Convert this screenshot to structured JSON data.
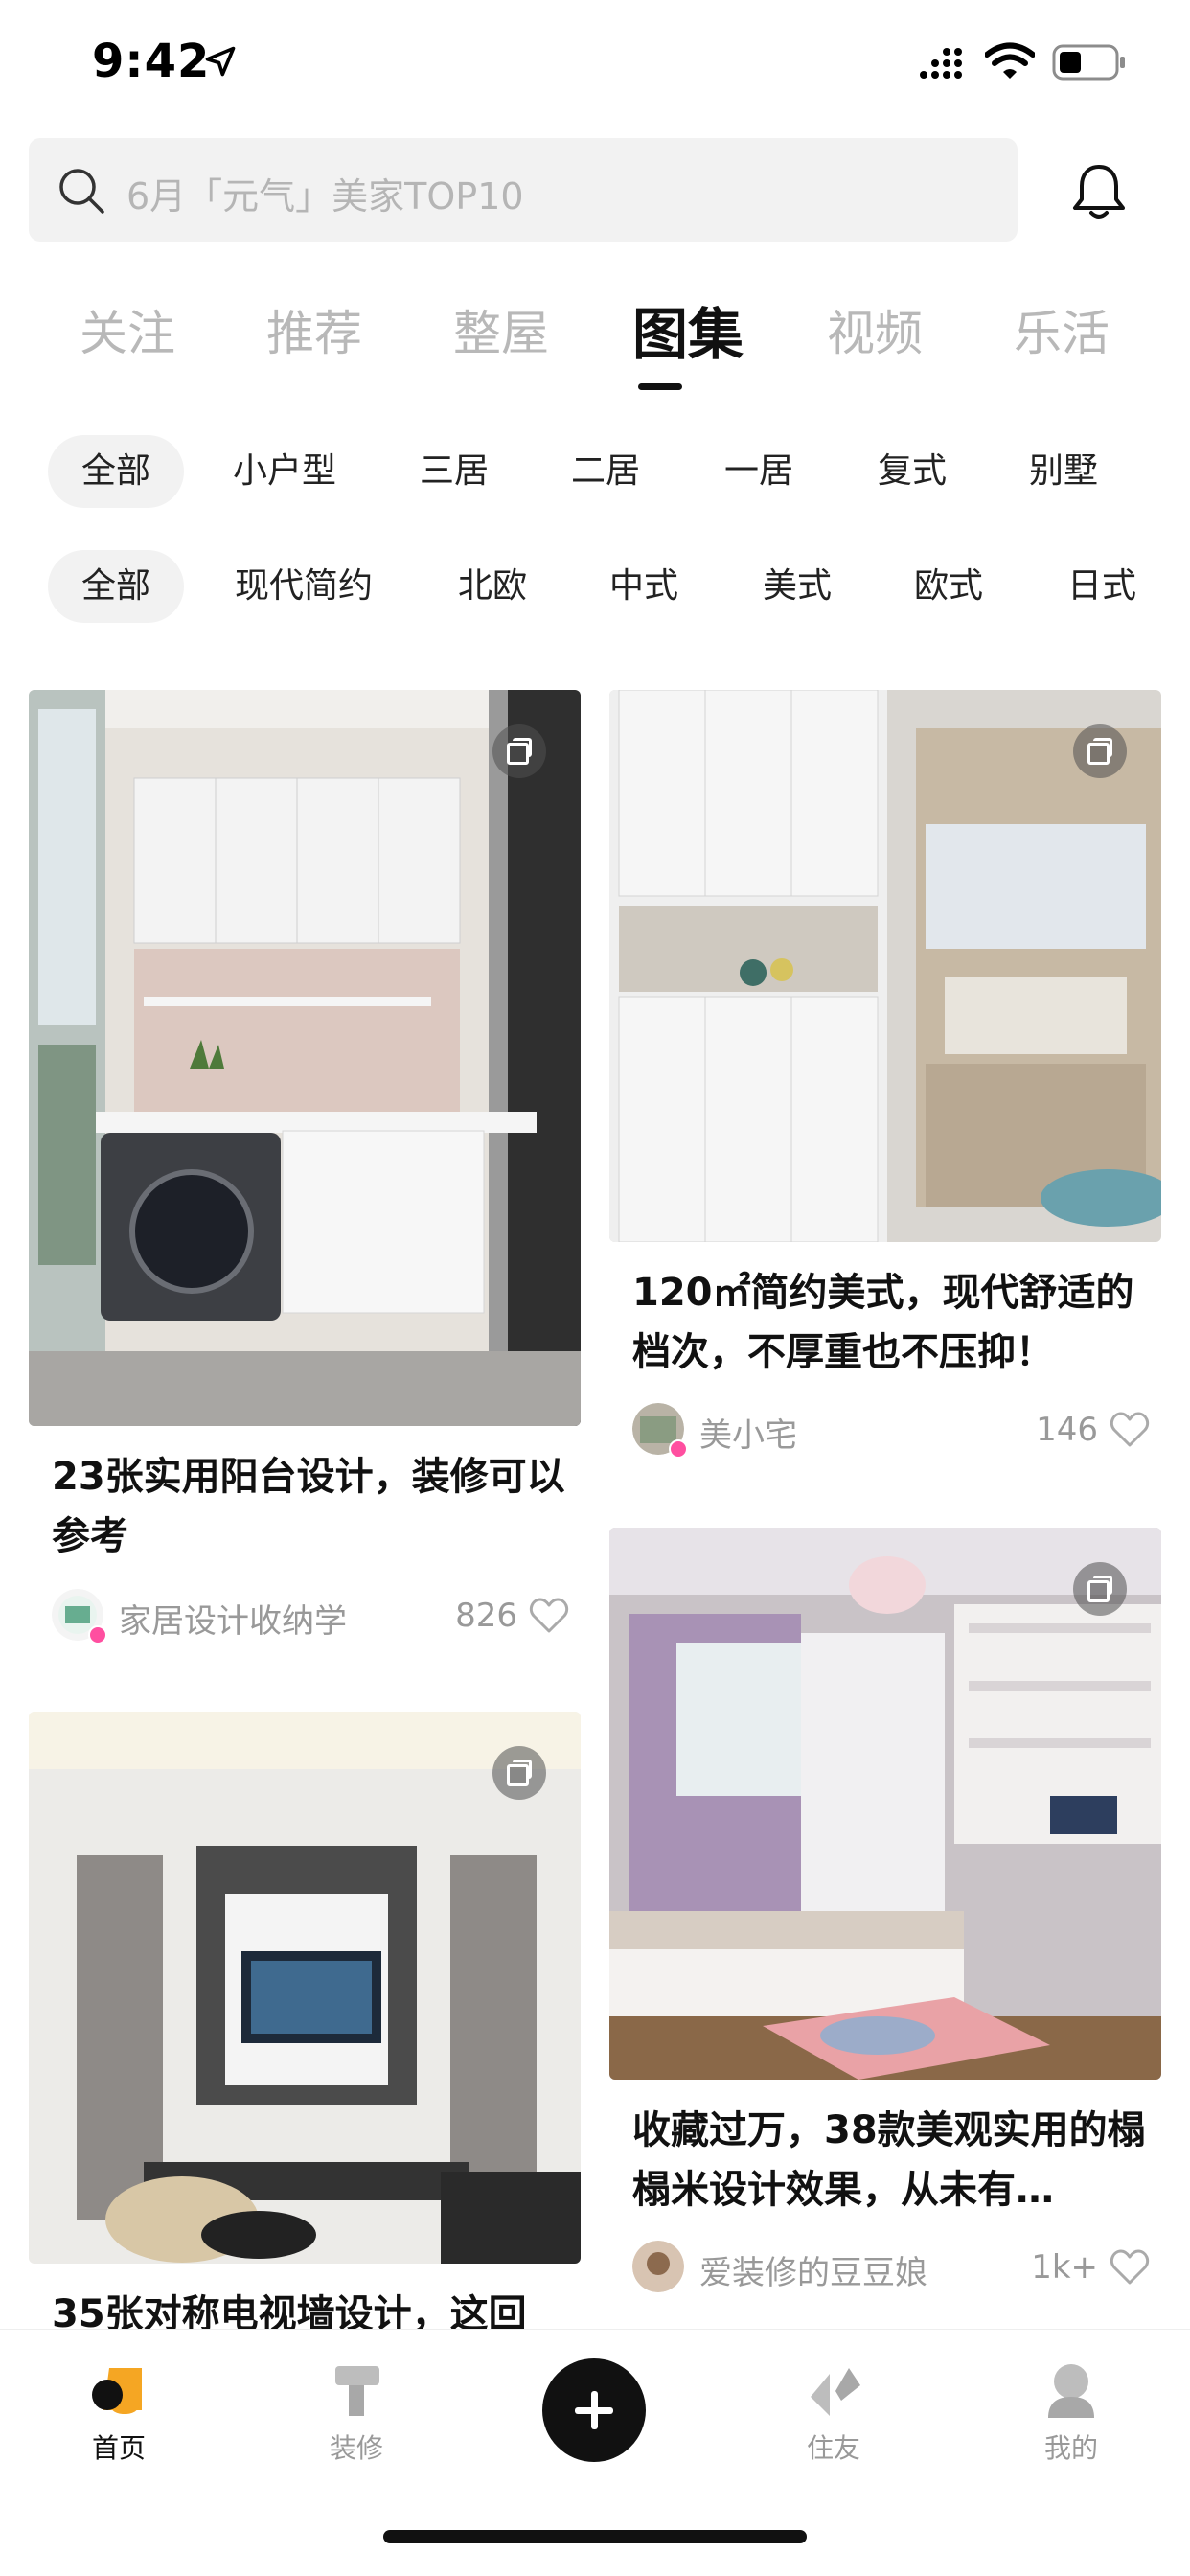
{
  "status_bar": {
    "time": "9:42"
  },
  "search": {
    "placeholder": "6月「元气」美家TOP10"
  },
  "tabs": [
    {
      "label": "关注"
    },
    {
      "label": "推荐"
    },
    {
      "label": "整屋"
    },
    {
      "label": "图集",
      "active": true
    },
    {
      "label": "视频"
    },
    {
      "label": "乐活"
    }
  ],
  "filters_layout": [
    "全部",
    "小户型",
    "三居",
    "二居",
    "一居",
    "复式",
    "别墅"
  ],
  "filters_style": [
    "全部",
    "现代简约",
    "北欧",
    "中式",
    "美式",
    "欧式",
    "日式"
  ],
  "cards": [
    {
      "title": "23张实用阳台设计，装修可以参考",
      "author": "家居设计收纳学",
      "likes": "826"
    },
    {
      "title": "120㎡简约美式，现代舒适的档次，不厚重也不压抑！",
      "author": "美小宅",
      "likes": "146"
    },
    {
      "title": "35张对称电视墙设计，这回",
      "author": "",
      "likes": ""
    },
    {
      "title": "收藏过万，38款美观实用的榻榻米设计效果，从未有…",
      "author": "爱装修的豆豆娘",
      "likes": "1k+"
    }
  ],
  "nav": [
    {
      "label": "首页",
      "icon": "home-icon",
      "active": true
    },
    {
      "label": "装修",
      "icon": "decorate-icon"
    },
    {
      "label": "",
      "icon": "add-icon"
    },
    {
      "label": "住友",
      "icon": "community-icon"
    },
    {
      "label": "我的",
      "icon": "profile-icon"
    }
  ],
  "colors": {
    "accent": "#f5a623",
    "text_primary": "#111111",
    "text_muted": "#999999",
    "chip_bg": "#f2f2f2"
  }
}
